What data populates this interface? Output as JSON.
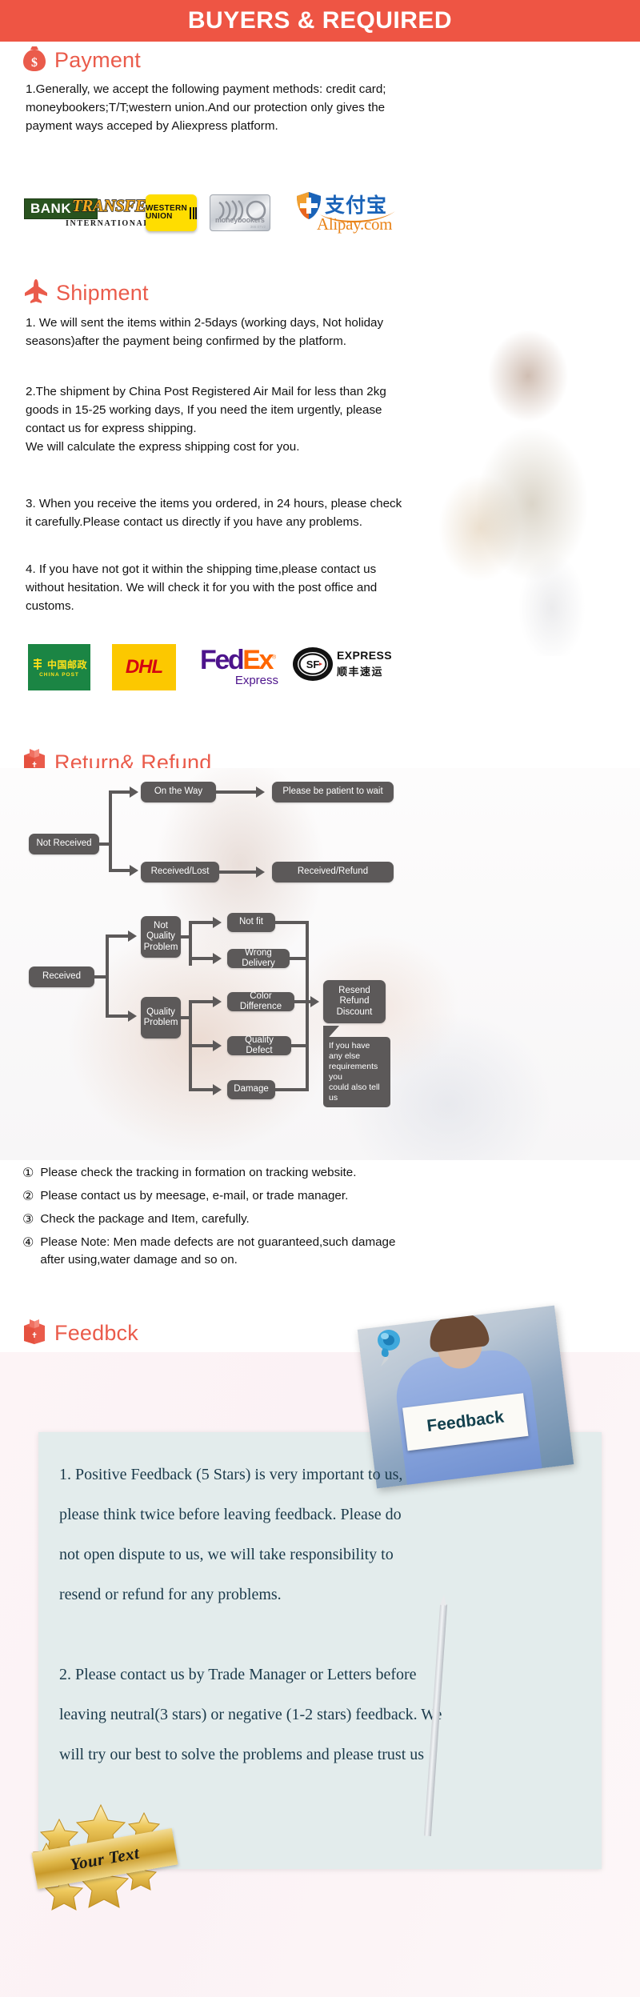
{
  "banner": {
    "title": "BUYERS & REQUIRED"
  },
  "payment": {
    "heading": "Payment",
    "icon": "money-bag-icon",
    "body": "1.Generally, we accept the following payment methods: credit card;\nmoneybookers;T/T;western union.And our protection only gives the\npayment ways acceped by Aliexpress platform.",
    "logos": [
      {
        "name": "bank-transfer-logo",
        "bank": "BANK",
        "transfer": "TRANSFER",
        "international": "INTERNATIONAL"
      },
      {
        "name": "western-union-logo",
        "line1": "WESTERN",
        "line2": "UNION"
      },
      {
        "name": "moneybookers-logo",
        "label": "moneybookers",
        "fine": "365 07V2"
      },
      {
        "name": "alipay-logo",
        "chinese": "支付宝",
        "domain": "Alipay.com"
      }
    ]
  },
  "shipment": {
    "heading": "Shipment",
    "icon": "airplane-icon",
    "paragraphs": [
      "1. We will sent the items within 2-5days (working days, Not holiday\nseasons)after the payment being confirmed by the platform.",
      "2.The shipment by China Post Registered Air Mail for less than  2kg\ngoods in 15-25 working days, If  you need the item urgently, please\ncontact us for express shipping.\nWe will calculate the express shipping cost for you.",
      "3. When you receive the items you ordered, in 24 hours, please check\n it carefully.Please contact us directly if you have any problems.",
      "4. If you have not got it within the shipping time,please contact us\nwithout hesitation. We will check it for you with the post office and\ncustoms."
    ],
    "carriers": [
      {
        "name": "china-post-logo",
        "chinese": "中国邮政",
        "english": "CHINA POST"
      },
      {
        "name": "dhl-logo",
        "label": "DHL"
      },
      {
        "name": "fedex-logo",
        "fed": "Fed",
        "ex": "Ex",
        "reg": "®",
        "sub": "Express"
      },
      {
        "name": "sf-express-logo",
        "mark": "SF",
        "english": "EXPRESS",
        "chinese": "顺丰速运"
      }
    ]
  },
  "returns": {
    "heading": "Return& Refund",
    "icon": "package-box-icon",
    "flow": {
      "not_received": "Not Received",
      "on_the_way": "On the Way",
      "please_wait": "Please be patient to wait",
      "received_lost": "Received/Lost",
      "received_refund": "Received/Refund",
      "received": "Received",
      "not_quality_problem": "Not\nQuality\nProblem",
      "quality_problem": "Quality\nProblem",
      "not_fit": "Not fit",
      "wrong_delivery": "Wrong Delivery",
      "color_difference": "Color Difference",
      "quality_defect": "Quality Defect",
      "damage": "Damage",
      "resend_refund_discount": "Resend\nRefund\nDiscount",
      "callout": "If you have any else\nrequirements you\ncould also tell us"
    },
    "notes": [
      {
        "marker": "①",
        "text": "Please check the tracking in formation on tracking website."
      },
      {
        "marker": "②",
        "text": "Please contact us by meesage, e-mail, or trade manager."
      },
      {
        "marker": "③",
        "text": "Check the package and Item, carefully."
      },
      {
        "marker": "④",
        "text": "Please Note: Men made defects  are not guaranteed,such damage\n   after using,water damage and so on."
      }
    ]
  },
  "feedback": {
    "heading": "Feedbck",
    "icon": "package-box-icon",
    "photo_sign": "Feedback",
    "body": "1. Positive Feedback (5 Stars) is very important to us,\nplease think twice before leaving feedback. Please do\nnot open dispute to us,   we will take responsibility to\nresend or refund for any problems.\n\n2. Please contact us by Trade Manager or Letters before\nleaving neutral(3 stars) or negative (1-2 stars) feedback. We\nwill try our best to solve the problems and please trust us"
  },
  "badge": {
    "text": "Your Text",
    "icon": "gold-stars-ribbon-icon"
  },
  "colors": {
    "banner_bg": "#ee5544",
    "heading_red": "#ea5b4b",
    "flow_node": "#5c5959",
    "feedback_panel": "#e3ecec",
    "feedback_text": "#1b3a4b"
  }
}
